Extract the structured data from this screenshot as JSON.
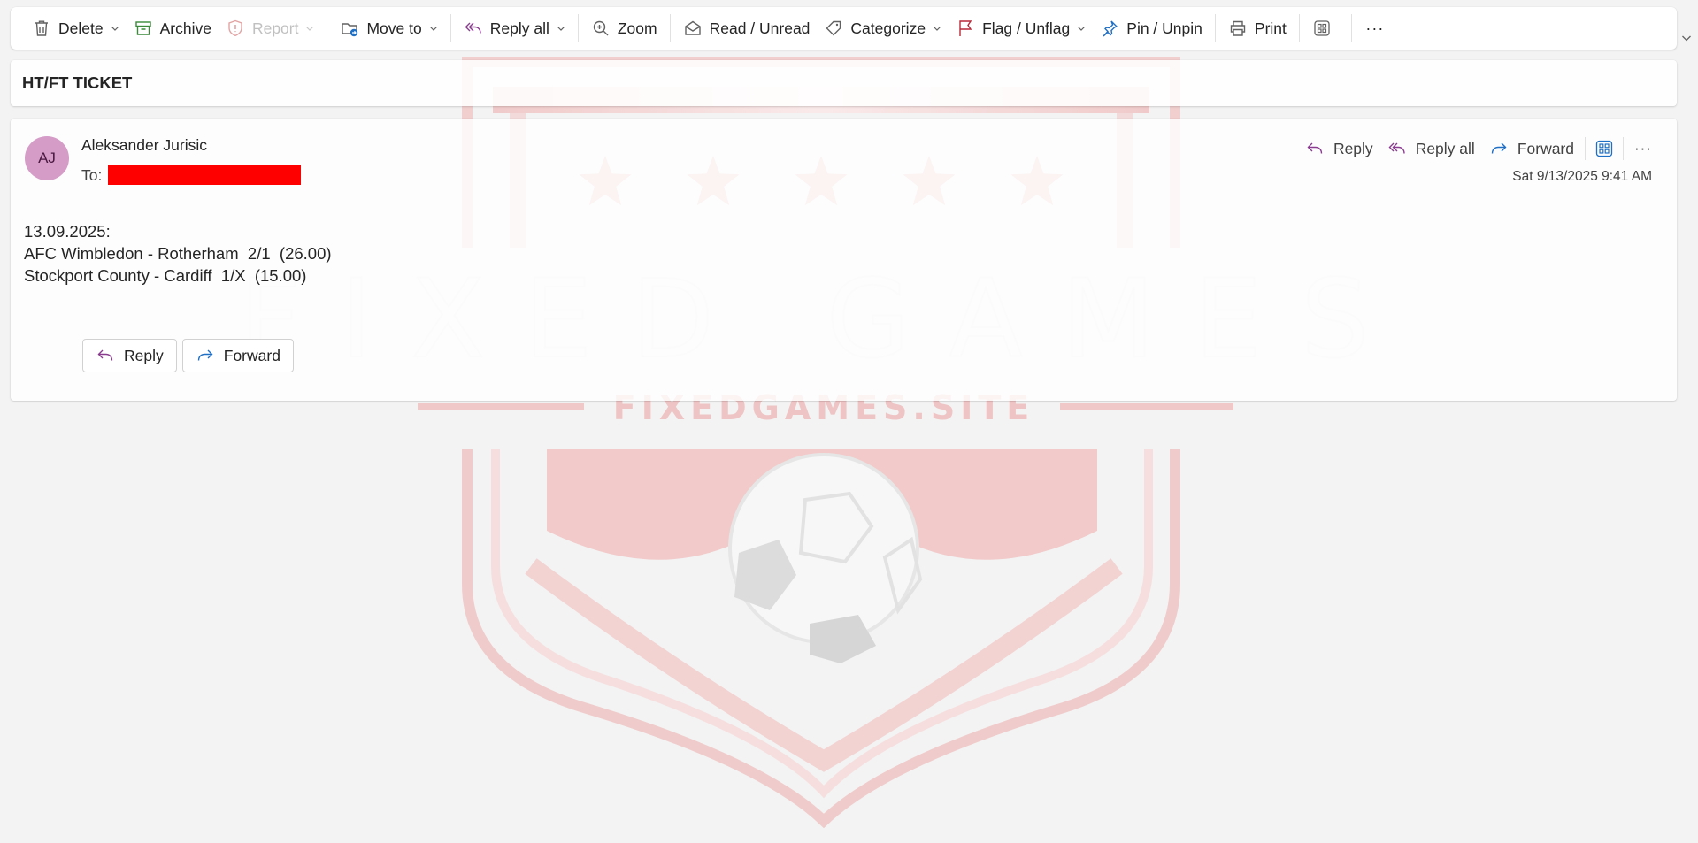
{
  "watermark": {
    "title": "FIXED GAMES",
    "site": "FIXEDGAMES.SITE",
    "color": "#e2b4b4"
  },
  "toolbar": {
    "delete_label": "Delete",
    "archive_label": "Archive",
    "report_label": "Report",
    "move_to_label": "Move to",
    "reply_all_label": "Reply all",
    "zoom_label": "Zoom",
    "read_unread_label": "Read / Unread",
    "categorize_label": "Categorize",
    "flag_label": "Flag / Unflag",
    "pin_label": "Pin / Unpin",
    "print_label": "Print",
    "more_label": "···"
  },
  "subject": "HT/FT TICKET",
  "message": {
    "avatar_initials": "AJ",
    "avatar_color": "#d49cc7",
    "sender": "Aleksander Jurisic",
    "to_label": "To:",
    "redaction_color": "#ff0000",
    "date": "Sat 9/13/2025 9:41 AM",
    "header_actions": {
      "reply_label": "Reply",
      "reply_all_label": "Reply all",
      "forward_label": "Forward",
      "more_label": "···"
    },
    "body_lines": [
      "13.09.2025:",
      "AFC Wimbledon - Rotherham  2/1  (26.00)",
      "Stockport County - Cardiff  1/X  (15.00)"
    ],
    "bottom_actions": {
      "reply_label": "Reply",
      "forward_label": "Forward"
    }
  },
  "colors": {
    "reply_icon": "#8a3b8f",
    "forward_icon": "#1f6fc4",
    "archive_icon": "#3a8a3a",
    "flag_icon": "#b82a3a",
    "pin_icon": "#1f6fc4",
    "move_icon": "#1f6fc4"
  }
}
